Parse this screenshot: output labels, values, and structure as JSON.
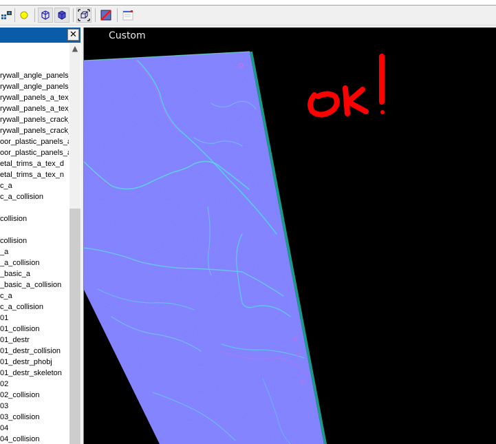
{
  "toolbar": {
    "buttons": [
      {
        "icon": "network-camera-icon"
      },
      {
        "icon": "light-bulb-icon"
      },
      {
        "icon": "wireframe-cube-icon",
        "pressed": true
      },
      {
        "icon": "solid-cube-icon",
        "pressed": true
      },
      {
        "icon": "bounding-box-icon",
        "pressed": true
      },
      {
        "icon": "no-texture-icon"
      },
      {
        "icon": "window-settings-icon"
      }
    ]
  },
  "panel": {
    "close_label": "✕",
    "items": [
      "",
      "",
      "rywall_angle_panels_",
      "rywall_angle_panels_",
      "rywall_panels_a_tex_",
      "rywall_panels_a_tex_",
      "rywall_panels_crack_",
      "rywall_panels_crack_",
      "oor_plastic_panels_a",
      "oor_plastic_panels_a",
      "etal_trims_a_tex_d",
      "etal_trims_a_tex_n",
      "c_a",
      "c_a_collision",
      "",
      "collision",
      "",
      "collision",
      "_a",
      "_a_collision",
      "_basic_a",
      "_basic_a_collision",
      "c_a",
      "c_a_collision",
      "01",
      "01_collision",
      "01_destr",
      "01_destr_collision",
      "01_destr_phobj",
      "01_destr_skeleton",
      "02",
      "02_collision",
      "03",
      "03_collision",
      "04",
      "04_collision"
    ]
  },
  "viewport": {
    "camera_label": "Custom",
    "annotation": "ok!",
    "annotation_color": "#ff0000",
    "surface_color": "#8080ff",
    "edge_color": "#1a9a8a"
  }
}
